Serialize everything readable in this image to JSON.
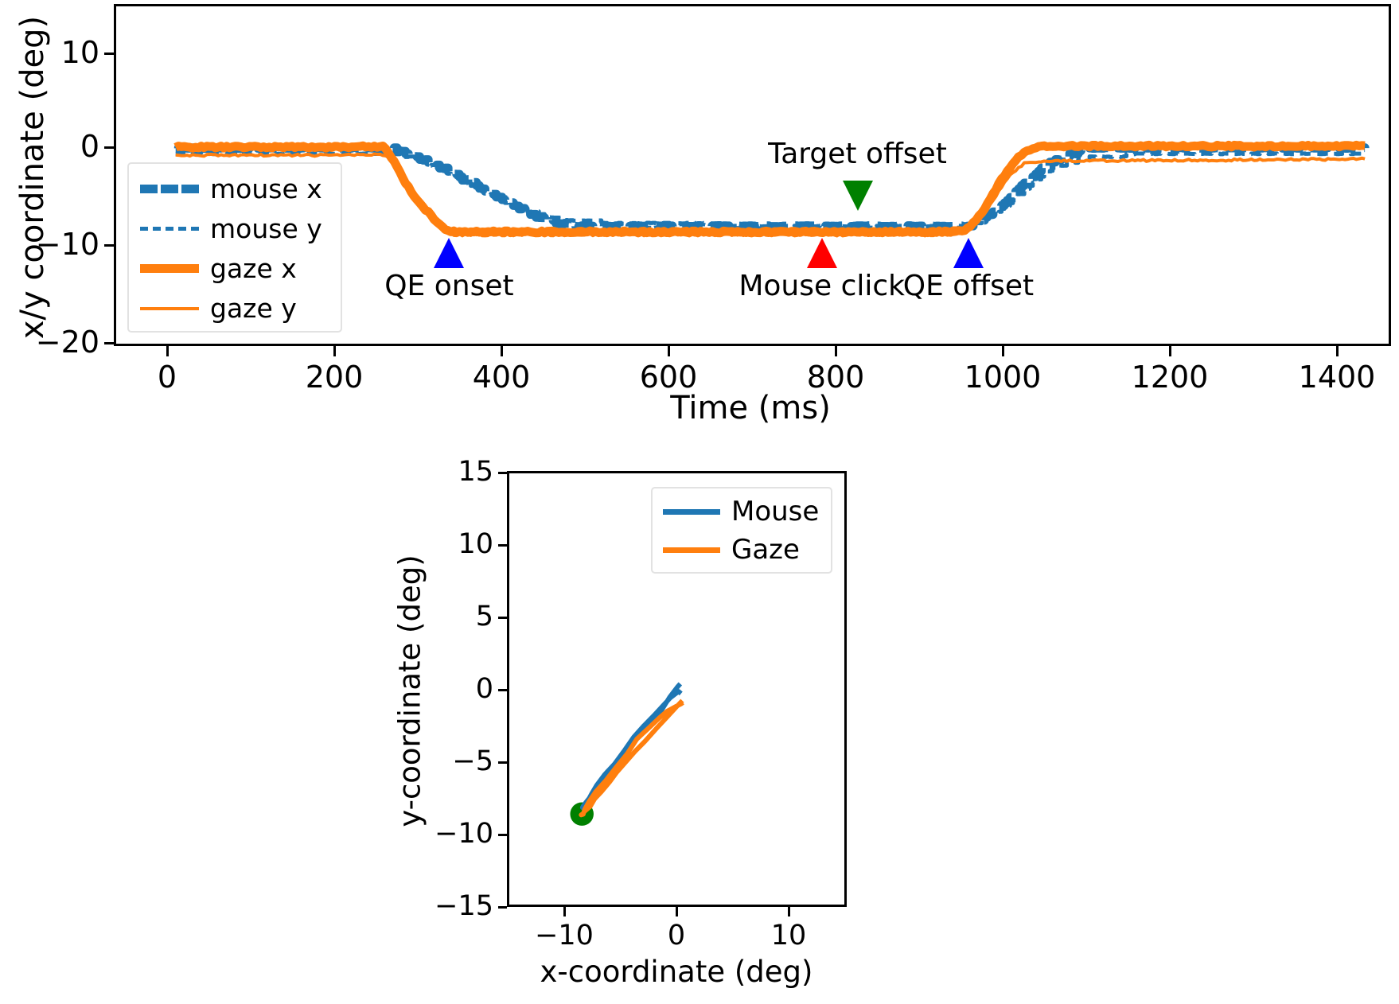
{
  "figure": {
    "background": "#ffffff",
    "colors": {
      "mouse": "#1f77b4",
      "gaze": "#ff7f0e",
      "qe_marker": "#0000ff",
      "click_marker": "#ff0000",
      "target_marker": "#008000",
      "axis": "#000000"
    }
  },
  "chart_data": [
    {
      "type": "line",
      "id": "timeseries",
      "title": "",
      "xlabel": "Time (ms)",
      "ylabel": "x/y coordinate (deg)",
      "xlim": [
        -75,
        1530
      ],
      "ylim": [
        -20,
        15
      ],
      "xticks": [
        0,
        200,
        400,
        600,
        800,
        1000,
        1200,
        1400
      ],
      "xticklabels": [
        "0",
        "200",
        "400",
        "600",
        "800",
        "1000",
        "1200",
        "1400"
      ],
      "yticks": [
        -20,
        -10,
        0,
        10
      ],
      "yticklabels": [
        "−20",
        "−10",
        "0",
        "10"
      ],
      "grid": false,
      "legend_position": "upper left",
      "series": [
        {
          "name": "mouse x",
          "color": "#1f77b4",
          "linestyle": "dashed",
          "linewidth": 11,
          "x": [
            0,
            40,
            80,
            120,
            160,
            200,
            240,
            265,
            280,
            300,
            320,
            340,
            360,
            380,
            400,
            420,
            440,
            460,
            480,
            500,
            540,
            580,
            620,
            660,
            700,
            760,
            820,
            880,
            940,
            990,
            1010,
            1030,
            1050,
            1070,
            1090,
            1110,
            1150,
            1200,
            1300,
            1400,
            1500
          ],
          "y": [
            0.3,
            0.3,
            0.3,
            0.3,
            0.3,
            0.3,
            0.35,
            0.35,
            0.1,
            -0.5,
            -1.2,
            -1.9,
            -2.8,
            -3.6,
            -4.6,
            -5.4,
            -6.2,
            -7.0,
            -7.4,
            -7.7,
            -7.8,
            -7.8,
            -7.9,
            -7.9,
            -7.9,
            -7.9,
            -7.9,
            -7.9,
            -7.9,
            -7.9,
            -7.5,
            -6.4,
            -5.0,
            -3.4,
            -2.0,
            -0.9,
            0.2,
            0.4,
            0.4,
            0.4,
            0.4
          ]
        },
        {
          "name": "mouse y",
          "color": "#1f77b4",
          "linestyle": "dashed",
          "linewidth": 5,
          "x": [
            0,
            40,
            80,
            120,
            160,
            200,
            240,
            265,
            285,
            305,
            325,
            345,
            365,
            385,
            405,
            425,
            445,
            465,
            485,
            505,
            545,
            585,
            625,
            665,
            705,
            765,
            825,
            885,
            945,
            995,
            1015,
            1035,
            1055,
            1075,
            1095,
            1115,
            1160,
            1210,
            1300,
            1400,
            1500
          ],
          "y": [
            -0.35,
            -0.35,
            -0.35,
            -0.35,
            -0.35,
            -0.35,
            -0.3,
            -0.3,
            -0.45,
            -0.9,
            -1.6,
            -2.4,
            -3.3,
            -4.1,
            -4.9,
            -5.6,
            -6.2,
            -6.7,
            -7.0,
            -7.2,
            -7.4,
            -7.5,
            -7.6,
            -7.6,
            -7.7,
            -7.7,
            -7.7,
            -7.7,
            -7.7,
            -7.7,
            -7.4,
            -6.5,
            -5.2,
            -3.8,
            -2.5,
            -1.5,
            -0.6,
            -0.4,
            -0.3,
            -0.3,
            -0.3
          ]
        },
        {
          "name": "gaze x",
          "color": "#ff7f0e",
          "linestyle": "solid",
          "linewidth": 11,
          "x": [
            0,
            40,
            80,
            120,
            160,
            200,
            240,
            262,
            270,
            280,
            290,
            300,
            310,
            320,
            330,
            340,
            350,
            400,
            500,
            600,
            700,
            800,
            900,
            980,
            995,
            1010,
            1025,
            1040,
            1055,
            1070,
            1090,
            1120,
            1200,
            1300,
            1400,
            1500
          ],
          "y": [
            0.4,
            0.4,
            0.4,
            0.4,
            0.4,
            0.4,
            0.45,
            0.45,
            -0.3,
            -1.8,
            -3.3,
            -4.6,
            -5.6,
            -6.5,
            -7.4,
            -8.1,
            -8.4,
            -8.4,
            -8.4,
            -8.4,
            -8.4,
            -8.4,
            -8.4,
            -8.4,
            -8.2,
            -7.2,
            -5.4,
            -3.2,
            -1.4,
            -0.1,
            0.45,
            0.5,
            0.5,
            0.5,
            0.5,
            0.5
          ]
        },
        {
          "name": "gaze y",
          "color": "#ff7f0e",
          "linestyle": "solid",
          "linewidth": 4,
          "x": [
            0,
            40,
            80,
            120,
            160,
            200,
            240,
            262,
            272,
            282,
            292,
            302,
            312,
            322,
            332,
            342,
            352,
            400,
            500,
            600,
            700,
            800,
            900,
            980,
            995,
            1010,
            1025,
            1040,
            1055,
            1070,
            1090,
            1120,
            1200,
            1300,
            1400,
            1500
          ],
          "y": [
            -0.45,
            -0.45,
            -0.45,
            -0.45,
            -0.45,
            -0.45,
            -0.4,
            -0.4,
            -1.0,
            -2.3,
            -3.7,
            -5.0,
            -6.0,
            -6.9,
            -7.7,
            -8.4,
            -8.7,
            -8.7,
            -8.7,
            -8.7,
            -8.7,
            -8.7,
            -8.7,
            -8.7,
            -8.5,
            -7.6,
            -5.9,
            -3.9,
            -2.3,
            -1.3,
            -1.1,
            -1.05,
            -1.0,
            -0.95,
            -0.9,
            -0.85
          ]
        }
      ],
      "annotations": [
        {
          "label": "QE onset",
          "x": 345,
          "y": -9.0,
          "marker": "triangle-up",
          "color": "#0000ff"
        },
        {
          "label": "Mouse click",
          "x": 815,
          "y": -9.0,
          "marker": "triangle-up",
          "color": "#ff0000"
        },
        {
          "label": "QE offset",
          "x": 1000,
          "y": -9.0,
          "marker": "triangle-up",
          "color": "#0000ff"
        },
        {
          "label": "Target offset",
          "x": 860,
          "y": -6.2,
          "marker": "triangle-down",
          "color": "#008000"
        }
      ],
      "legend": [
        {
          "label": "mouse x",
          "color": "#1f77b4",
          "style": "thick-dash"
        },
        {
          "label": "mouse y",
          "color": "#1f77b4",
          "style": "thin-dash"
        },
        {
          "label": "gaze x",
          "color": "#ff7f0e",
          "style": "thick-solid"
        },
        {
          "label": "gaze y",
          "color": "#ff7f0e",
          "style": "thin-solid"
        }
      ]
    },
    {
      "type": "line",
      "id": "trajectory",
      "title": "",
      "xlabel": "x-coordinate (deg)",
      "ylabel": "y-coordinate (deg)",
      "xlim": [
        -15,
        15
      ],
      "ylim": [
        -15,
        15
      ],
      "xticks": [
        -10,
        0,
        10
      ],
      "xticklabels": [
        "−10",
        "0",
        "10"
      ],
      "yticks": [
        -15,
        -10,
        -5,
        0,
        5,
        10,
        15
      ],
      "yticklabels": [
        "−15",
        "−10",
        "−5",
        "0",
        "5",
        "10",
        "15"
      ],
      "grid": false,
      "legend_position": "upper right",
      "target": {
        "x": -8.5,
        "y": -8.7,
        "color": "#008000",
        "radius_deg": 1.05,
        "label": "target"
      },
      "series": [
        {
          "name": "Mouse",
          "color": "#1f77b4",
          "linewidth": 6,
          "x": [
            0.35,
            0.1,
            -0.6,
            -1.4,
            -2.3,
            -3.1,
            -3.9,
            -4.7,
            -5.4,
            -6.1,
            -6.8,
            -7.4,
            -7.8,
            -8.1,
            -8.3,
            -8.4,
            -8.3,
            -8.0,
            -7.6,
            -7.1,
            -6.4,
            -5.6,
            -4.7,
            -3.8,
            -2.9,
            -2.0,
            -1.2,
            -0.5,
            0.1,
            0.4
          ],
          "y": [
            0.4,
            0.1,
            -0.6,
            -1.4,
            -2.2,
            -3.0,
            -3.7,
            -4.4,
            -5.1,
            -5.7,
            -6.4,
            -7.0,
            -7.5,
            -7.9,
            -8.1,
            -8.2,
            -8.1,
            -7.8,
            -7.3,
            -6.7,
            -6.0,
            -5.2,
            -4.3,
            -3.4,
            -2.6,
            -1.8,
            -1.1,
            -0.6,
            -0.2,
            -0.3
          ]
        },
        {
          "name": "Gaze",
          "color": "#ff7f0e",
          "linewidth": 6,
          "x": [
            0.5,
            0.0,
            -0.9,
            -1.9,
            -2.8,
            -3.7,
            -4.5,
            -5.3,
            -6.0,
            -6.7,
            -7.3,
            -7.8,
            -8.2,
            -8.4,
            -8.5,
            -8.4,
            -8.2,
            -7.8,
            -7.2,
            -6.4,
            -5.5,
            -4.5,
            -3.5,
            -2.5,
            -1.6,
            -0.8,
            -0.1,
            0.3,
            0.5
          ],
          "y": [
            -0.85,
            -1.3,
            -2.0,
            -2.8,
            -3.6,
            -4.4,
            -5.1,
            -5.8,
            -6.5,
            -7.1,
            -7.7,
            -8.2,
            -8.5,
            -8.7,
            -8.8,
            -8.7,
            -8.4,
            -7.9,
            -7.2,
            -6.4,
            -5.5,
            -4.5,
            -3.5,
            -2.7,
            -2.0,
            -1.5,
            -1.2,
            -1.0,
            -0.9
          ]
        }
      ],
      "legend": [
        {
          "label": "Mouse",
          "color": "#1f77b4",
          "style": "solid"
        },
        {
          "label": "Gaze",
          "color": "#ff7f0e",
          "style": "solid"
        }
      ]
    }
  ]
}
